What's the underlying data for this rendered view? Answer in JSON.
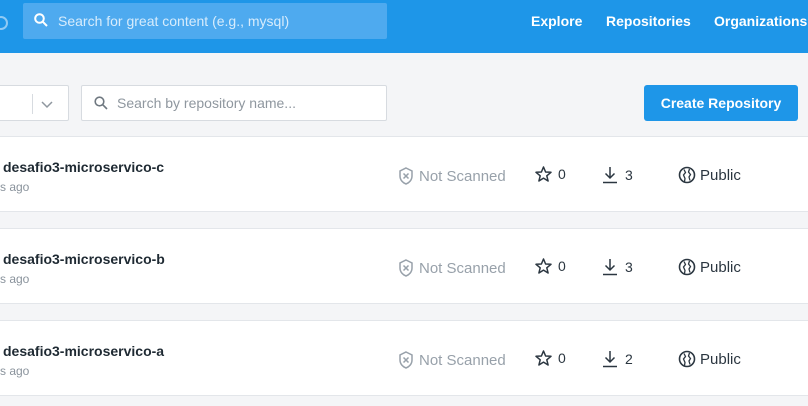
{
  "header": {
    "search_placeholder": "Search for great content (e.g., mysql)",
    "nav": [
      "Explore",
      "Repositories",
      "Organizations"
    ]
  },
  "toolbar": {
    "repo_search_placeholder": "Search by repository name...",
    "create_label": "Create Repository"
  },
  "repos": [
    {
      "name": "desafio3-microservico-c",
      "updated": "s ago",
      "scan": "Not Scanned",
      "stars": "0",
      "pulls": "3",
      "visibility": "Public"
    },
    {
      "name": "desafio3-microservico-b",
      "updated": "s ago",
      "scan": "Not Scanned",
      "stars": "0",
      "pulls": "3",
      "visibility": "Public"
    },
    {
      "name": "desafio3-microservico-a",
      "updated": "s ago",
      "scan": "Not Scanned",
      "stars": "0",
      "pulls": "2",
      "visibility": "Public"
    }
  ],
  "colors": {
    "brand": "#1e96e8",
    "page_bg": "#f4f5f7"
  },
  "icons": {
    "search": "search-icon",
    "star": "star-icon",
    "download": "download-icon",
    "shield": "shield-x-icon",
    "globe": "globe-icon"
  }
}
